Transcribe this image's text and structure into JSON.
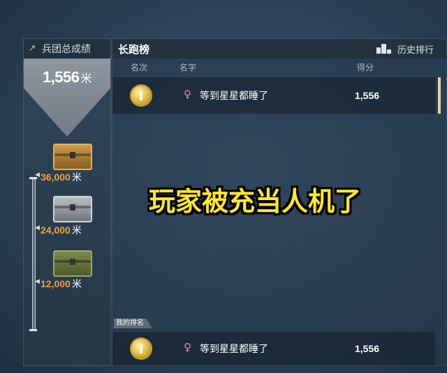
{
  "left_panel": {
    "header": "兵团总成绩",
    "total_score": "1,556",
    "unit": "米",
    "rewards": [
      {
        "threshold": "36,000",
        "unit": "米",
        "chest": "gold-chest"
      },
      {
        "threshold": "24,000",
        "unit": "米",
        "chest": "silver-chest"
      },
      {
        "threshold": "12,000",
        "unit": "米",
        "chest": "green-chest"
      }
    ]
  },
  "leaderboard": {
    "title": "长跑榜",
    "history_label": "历史排行",
    "columns": {
      "rank": "名次",
      "name": "名字",
      "score": "得分"
    },
    "top_row": {
      "gender_icon": "♀",
      "name": "等到星星都睡了",
      "score": "1,556"
    },
    "my_rank_label": "我的排名",
    "my_row": {
      "gender_icon": "♀",
      "name": "等到星星都睡了",
      "score": "1,556"
    }
  },
  "overlay_caption": "玩家被充当人机了",
  "colors": {
    "accent_orange": "#f0a038",
    "caption_yellow": "#ffe92a",
    "medal_gold": "#e8c04d"
  }
}
